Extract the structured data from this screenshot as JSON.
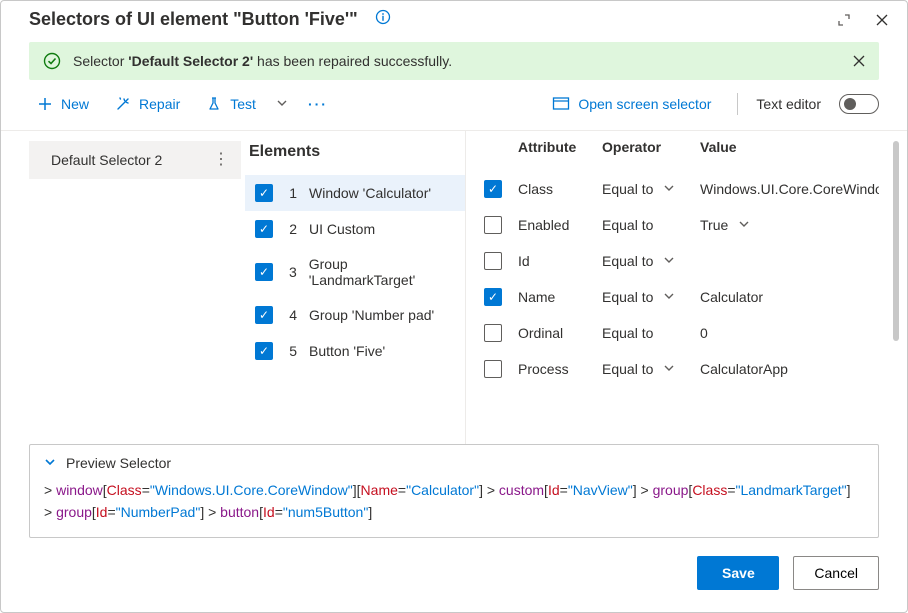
{
  "header": {
    "title": "Selectors of UI element \"Button 'Five'\""
  },
  "banner": {
    "prefix": "Selector ",
    "name": "'Default Selector 2'",
    "suffix": " has been repaired successfully."
  },
  "toolbar": {
    "new": "New",
    "repair": "Repair",
    "test": "Test",
    "open_screen": "Open screen selector",
    "text_editor": "Text editor"
  },
  "left": {
    "items": [
      {
        "label": "Default Selector 2"
      }
    ]
  },
  "elements": {
    "title": "Elements",
    "rows": [
      {
        "n": "1",
        "label": "Window 'Calculator'",
        "checked": true,
        "selected": true
      },
      {
        "n": "2",
        "label": "UI Custom",
        "checked": true,
        "selected": false
      },
      {
        "n": "3",
        "label": "Group 'LandmarkTarget'",
        "checked": true,
        "selected": false
      },
      {
        "n": "4",
        "label": "Group 'Number pad'",
        "checked": true,
        "selected": false
      },
      {
        "n": "5",
        "label": "Button 'Five'",
        "checked": true,
        "selected": false
      }
    ]
  },
  "attributes": {
    "head": {
      "attr": "Attribute",
      "op": "Operator",
      "val": "Value"
    },
    "rows": [
      {
        "checked": true,
        "attr": "Class",
        "op": "Equal to",
        "val": "Windows.UI.Core.CoreWindow",
        "opChev": true,
        "valChev": false
      },
      {
        "checked": false,
        "attr": "Enabled",
        "op": "Equal to",
        "val": "True",
        "opChev": false,
        "valChev": true
      },
      {
        "checked": false,
        "attr": "Id",
        "op": "Equal to",
        "val": "",
        "opChev": true,
        "valChev": false
      },
      {
        "checked": true,
        "attr": "Name",
        "op": "Equal to",
        "val": "Calculator",
        "opChev": true,
        "valChev": false
      },
      {
        "checked": false,
        "attr": "Ordinal",
        "op": "Equal to",
        "val": "0",
        "opChev": false,
        "valChev": false
      },
      {
        "checked": false,
        "attr": "Process",
        "op": "Equal to",
        "val": "CalculatorApp",
        "opChev": true,
        "valChev": false
      }
    ]
  },
  "preview": {
    "title": "Preview Selector",
    "parts": [
      {
        "t": "punct",
        "v": "> "
      },
      {
        "t": "el",
        "v": "window"
      },
      {
        "t": "punct",
        "v": "["
      },
      {
        "t": "attr",
        "v": "Class"
      },
      {
        "t": "eq",
        "v": "="
      },
      {
        "t": "val",
        "v": "\"Windows.UI.Core.CoreWindow\""
      },
      {
        "t": "punct",
        "v": "]["
      },
      {
        "t": "attr",
        "v": "Name"
      },
      {
        "t": "eq",
        "v": "="
      },
      {
        "t": "val",
        "v": "\"Calculator\""
      },
      {
        "t": "punct",
        "v": "] > "
      },
      {
        "t": "el",
        "v": "custom"
      },
      {
        "t": "punct",
        "v": "["
      },
      {
        "t": "attr",
        "v": "Id"
      },
      {
        "t": "eq",
        "v": "="
      },
      {
        "t": "val",
        "v": "\"NavView\""
      },
      {
        "t": "punct",
        "v": "] > "
      },
      {
        "t": "el",
        "v": "group"
      },
      {
        "t": "punct",
        "v": "["
      },
      {
        "t": "attr",
        "v": "Class"
      },
      {
        "t": "eq",
        "v": "="
      },
      {
        "t": "val",
        "v": "\"LandmarkTarget\""
      },
      {
        "t": "punct",
        "v": "] "
      },
      {
        "t": "br",
        "v": ""
      },
      {
        "t": "punct",
        "v": "> "
      },
      {
        "t": "el",
        "v": "group"
      },
      {
        "t": "punct",
        "v": "["
      },
      {
        "t": "attr",
        "v": "Id"
      },
      {
        "t": "eq",
        "v": "="
      },
      {
        "t": "val",
        "v": "\"NumberPad\""
      },
      {
        "t": "punct",
        "v": "] > "
      },
      {
        "t": "el",
        "v": "button"
      },
      {
        "t": "punct",
        "v": "["
      },
      {
        "t": "attr",
        "v": "Id"
      },
      {
        "t": "eq",
        "v": "="
      },
      {
        "t": "val",
        "v": "\"num5Button\""
      },
      {
        "t": "punct",
        "v": "]"
      }
    ]
  },
  "footer": {
    "save": "Save",
    "cancel": "Cancel"
  }
}
